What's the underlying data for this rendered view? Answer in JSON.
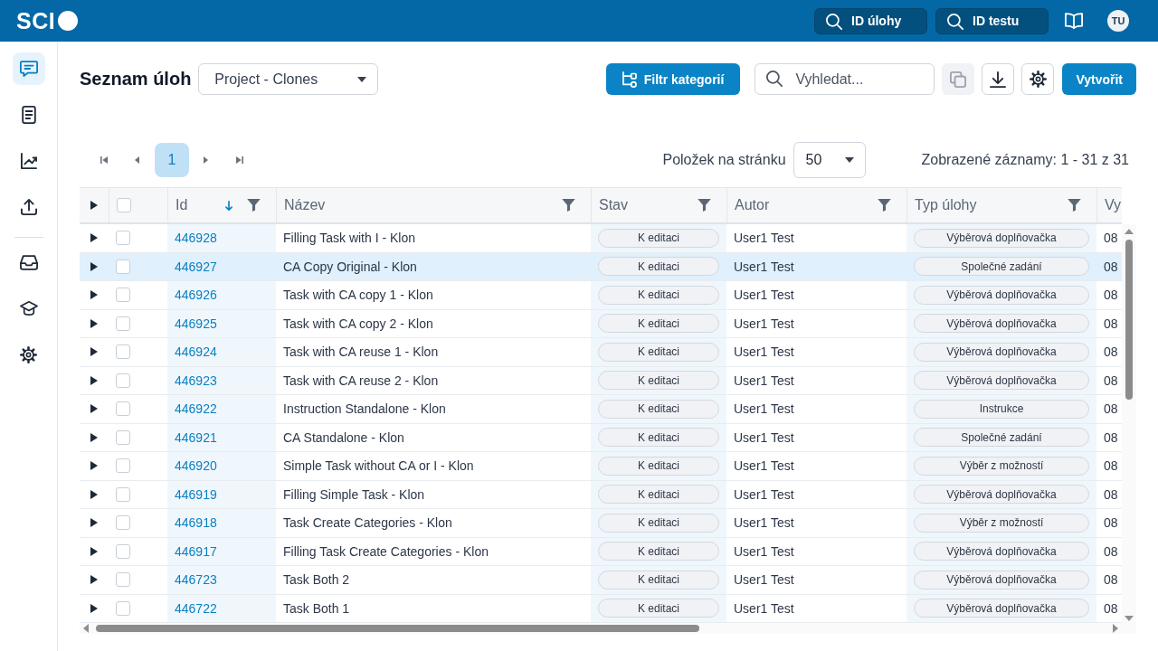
{
  "topbar": {
    "logo": "SCI",
    "quick_searches": [
      {
        "placeholder": "ID úlohy"
      },
      {
        "placeholder": "ID testu"
      }
    ],
    "avatar": "TU"
  },
  "sidebar": {
    "groups": [
      {
        "items": [
          {
            "selected": true
          },
          {
            "selected": false
          },
          {
            "selected": false
          },
          {
            "selected": false
          }
        ]
      },
      {
        "items": [
          {
            "selected": false
          },
          {
            "selected": false
          },
          {
            "selected": false
          }
        ]
      }
    ]
  },
  "toolbar": {
    "title": "Seznam úloh",
    "project_select": {
      "value": "Project - Clones"
    },
    "filter_button": "Filtr kategorií",
    "search": {
      "placeholder": "Vyhledat..."
    },
    "icon_buttons": [
      {
        "disabled": true
      },
      {
        "disabled": false
      },
      {
        "disabled": false
      }
    ],
    "create_button": "Vytvořit"
  },
  "pagination": {
    "pages": [
      {
        "label": "1",
        "selected": true
      }
    ],
    "page_size": {
      "label": "Položek na stránku",
      "value": "50"
    },
    "summary": "Zobrazené záznamy: 1 - 31 z 31"
  },
  "table": {
    "header": {
      "expanded": false,
      "checked": false
    },
    "columns": [
      {
        "label": "Id",
        "kind": "link",
        "sorted": true,
        "filterable": true
      },
      {
        "label": "Název",
        "kind": "text",
        "sorted": false,
        "filterable": true
      },
      {
        "label": "Stav",
        "kind": "badge",
        "sorted": false,
        "filterable": true
      },
      {
        "label": "Autor",
        "kind": "text",
        "sorted": false,
        "filterable": true
      },
      {
        "label": "Typ úlohy",
        "kind": "badge",
        "sorted": false,
        "filterable": true
      },
      {
        "label": "Vy",
        "kind": "text",
        "sorted": false,
        "filterable": false
      }
    ],
    "rows": [
      {
        "expanded": false,
        "checked": false,
        "selected": false,
        "id": "446928",
        "name": "Filling Task with I - Klon",
        "status": "K editaci",
        "author": "User1 Test",
        "type": "Výběrová doplňovačka",
        "column_6": "08"
      },
      {
        "expanded": false,
        "checked": false,
        "selected": true,
        "id": "446927",
        "name": "CA Copy Original - Klon",
        "status": "K editaci",
        "author": "User1 Test",
        "type": "Společné zadání",
        "column_6": "08"
      },
      {
        "expanded": false,
        "checked": false,
        "selected": false,
        "id": "446926",
        "name": "Task with CA copy 1 - Klon",
        "status": "K editaci",
        "author": "User1 Test",
        "type": "Výběrová doplňovačka",
        "column_6": "08"
      },
      {
        "expanded": false,
        "checked": false,
        "selected": false,
        "id": "446925",
        "name": "Task with CA copy 2 - Klon",
        "status": "K editaci",
        "author": "User1 Test",
        "type": "Výběrová doplňovačka",
        "column_6": "08"
      },
      {
        "expanded": false,
        "checked": false,
        "selected": false,
        "id": "446924",
        "name": "Task with CA reuse 1 - Klon",
        "status": "K editaci",
        "author": "User1 Test",
        "type": "Výběrová doplňovačka",
        "column_6": "08"
      },
      {
        "expanded": false,
        "checked": false,
        "selected": false,
        "id": "446923",
        "name": "Task with CA reuse 2 - Klon",
        "status": "K editaci",
        "author": "User1 Test",
        "type": "Výběrová doplňovačka",
        "column_6": "08"
      },
      {
        "expanded": false,
        "checked": false,
        "selected": false,
        "id": "446922",
        "name": "Instruction Standalone - Klon",
        "status": "K editaci",
        "author": "User1 Test",
        "type": "Instrukce",
        "column_6": "08"
      },
      {
        "expanded": false,
        "checked": false,
        "selected": false,
        "id": "446921",
        "name": "CA Standalone - Klon",
        "status": "K editaci",
        "author": "User1 Test",
        "type": "Společné zadání",
        "column_6": "08"
      },
      {
        "expanded": false,
        "checked": false,
        "selected": false,
        "id": "446920",
        "name": "Simple Task without CA or I - Klon",
        "status": "K editaci",
        "author": "User1 Test",
        "type": "Výběr z možností",
        "column_6": "08"
      },
      {
        "expanded": false,
        "checked": false,
        "selected": false,
        "id": "446919",
        "name": "Filling Simple Task - Klon",
        "status": "K editaci",
        "author": "User1 Test",
        "type": "Výběrová doplňovačka",
        "column_6": "08"
      },
      {
        "expanded": false,
        "checked": false,
        "selected": false,
        "id": "446918",
        "name": "Task Create Categories - Klon",
        "status": "K editaci",
        "author": "User1 Test",
        "type": "Výběr z možností",
        "column_6": "08"
      },
      {
        "expanded": false,
        "checked": false,
        "selected": false,
        "id": "446917",
        "name": "Filling Task Create Categories - Klon",
        "status": "K editaci",
        "author": "User1 Test",
        "type": "Výběrová doplňovačka",
        "column_6": "08"
      },
      {
        "expanded": false,
        "checked": false,
        "selected": false,
        "id": "446723",
        "name": "Task Both 2",
        "status": "K editaci",
        "author": "User1 Test",
        "type": "Výběrová doplňovačka",
        "column_6": "08"
      },
      {
        "expanded": false,
        "checked": false,
        "selected": false,
        "id": "446722",
        "name": "Task Both 1",
        "status": "K editaci",
        "author": "User1 Test",
        "type": "Výběrová doplňovačka",
        "column_6": "08"
      }
    ]
  }
}
